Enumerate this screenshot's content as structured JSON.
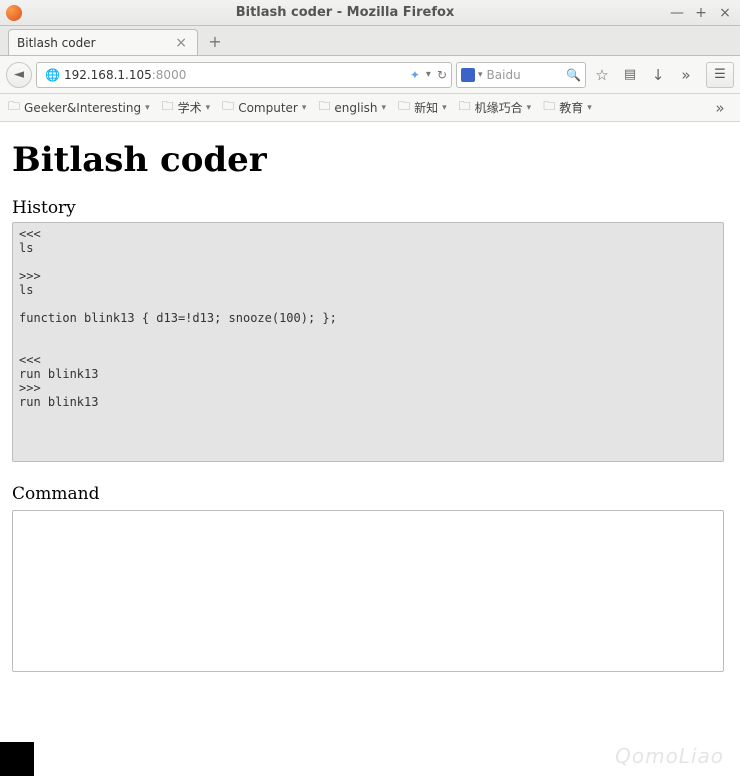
{
  "window": {
    "title": "Bitlash coder - Mozilla Firefox"
  },
  "tab": {
    "title": "Bitlash coder"
  },
  "url": {
    "host": "192.168.1.105",
    "port": ":8000"
  },
  "search": {
    "engine": "Baidu",
    "placeholder": "Baidu"
  },
  "bookmarks": [
    {
      "label": "Geeker&Interesting"
    },
    {
      "label": "学术"
    },
    {
      "label": "Computer"
    },
    {
      "label": "english"
    },
    {
      "label": "新知"
    },
    {
      "label": "机缘巧合"
    },
    {
      "label": "教育"
    }
  ],
  "page": {
    "heading": "Bitlash coder",
    "history_label": "History",
    "history_text": "<<<\nls\n\n>>>\nls\n\nfunction blink13 { d13=!d13; snooze(100); };\n\n\n<<<\nrun blink13\n>>>\nrun blink13\n",
    "command_label": "Command",
    "command_text": ""
  },
  "watermark": "QomoLiao"
}
